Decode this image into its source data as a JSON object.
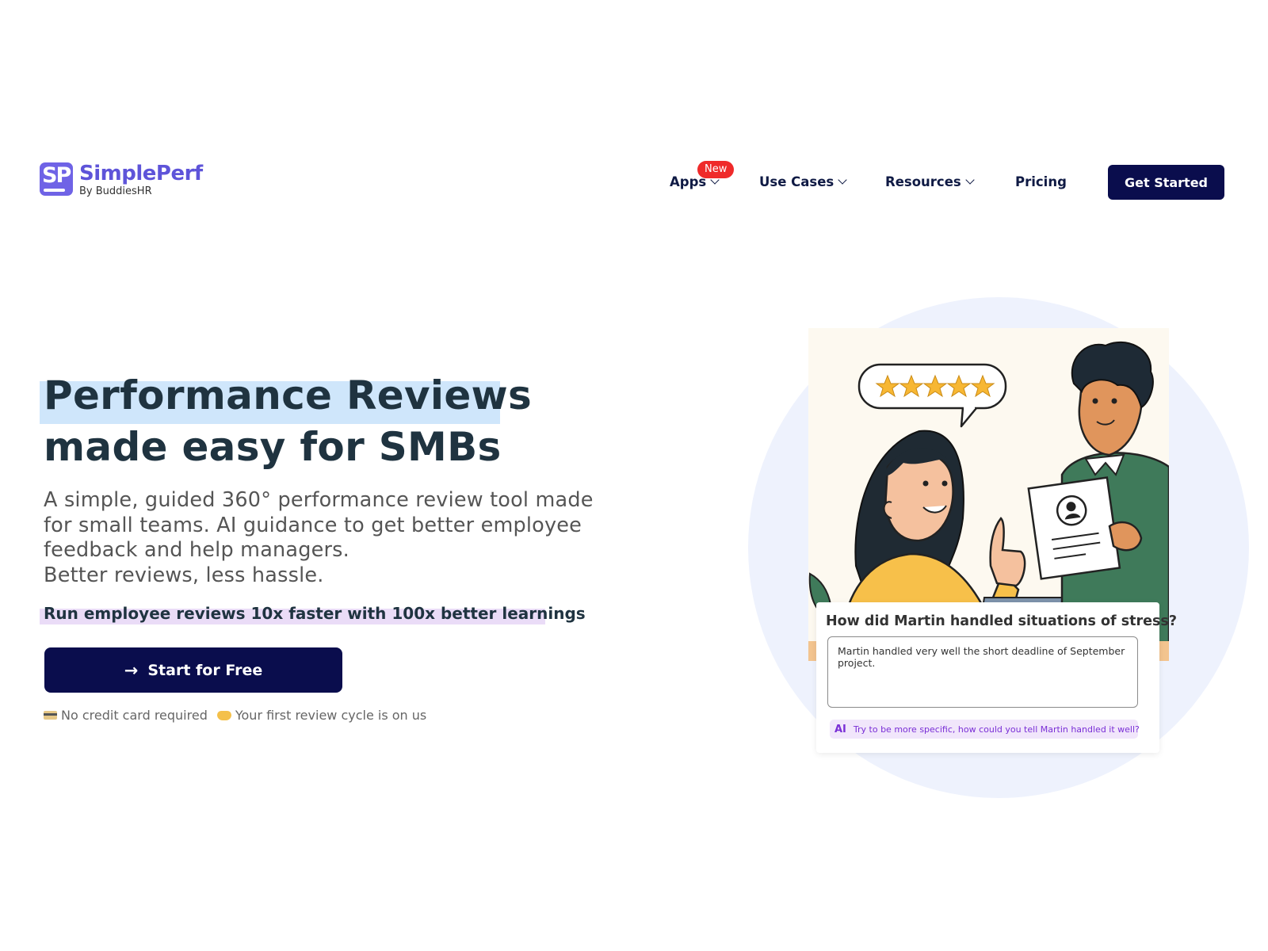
{
  "brand": {
    "logo_letters": "SP",
    "name": "SimplePerf",
    "byline": "By BuddiesHR",
    "accent_color": "#6f63e6"
  },
  "nav": {
    "apps_label": "Apps",
    "apps_badge": "New",
    "use_cases_label": "Use Cases",
    "resources_label": "Resources",
    "pricing_label": "Pricing",
    "cta_label": "Get Started"
  },
  "hero": {
    "headline_line1": "Performance Reviews",
    "headline_line2": "made easy for SMBs",
    "subtitle_lines": [
      "A simple, guided 360° performance review tool made",
      "for small teams. AI guidance to get better employee",
      "feedback and help managers.",
      "Better reviews, less hassle."
    ],
    "tagline": "Run employee reviews 10x faster with 100x better learnings",
    "cta_label": "Start for Free",
    "note_no_card": "No credit card required",
    "note_first_cycle": "Your first review cycle is on us"
  },
  "illustration": {
    "rating_stars": 5,
    "review_question": "How did Martin handled situations of stress?",
    "review_answer": "Martin handled very well the short deadline of September project.",
    "ai_label": "AI",
    "ai_hint": "Try to be more specific, how could you tell Martin handled it well?"
  },
  "colors": {
    "navy": "#0a0d4d",
    "heading": "#1f3340",
    "highlight_blue": "#cfe6fb",
    "highlight_purple": "#eadcf7",
    "badge_red": "#ef2a2a",
    "circle_bg": "#eef2fd"
  }
}
